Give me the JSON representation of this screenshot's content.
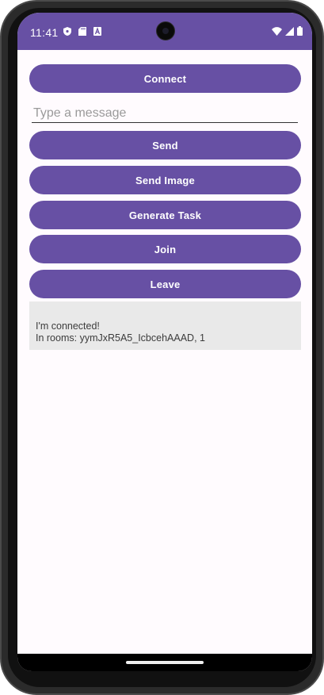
{
  "status_bar": {
    "time": "11:41",
    "left_icons": [
      "shield-icon",
      "sd-card-icon",
      "font-a-icon"
    ],
    "right_icons": [
      "wifi-icon",
      "signal-icon",
      "battery-icon"
    ],
    "background": "#6750a4"
  },
  "controls": {
    "connect_label": "Connect",
    "message_placeholder": "Type a message",
    "message_value": "",
    "send_label": "Send",
    "send_image_label": "Send Image",
    "generate_task_label": "Generate Task",
    "join_label": "Join",
    "leave_label": "Leave"
  },
  "log": {
    "lines": [
      "I'm connected!",
      "In rooms: yymJxR5A5_IcbcehAAAD, 1"
    ]
  },
  "colors": {
    "accent": "#6750a4",
    "log_background": "#e9e9e9",
    "screen_background": "#fffbfe"
  }
}
